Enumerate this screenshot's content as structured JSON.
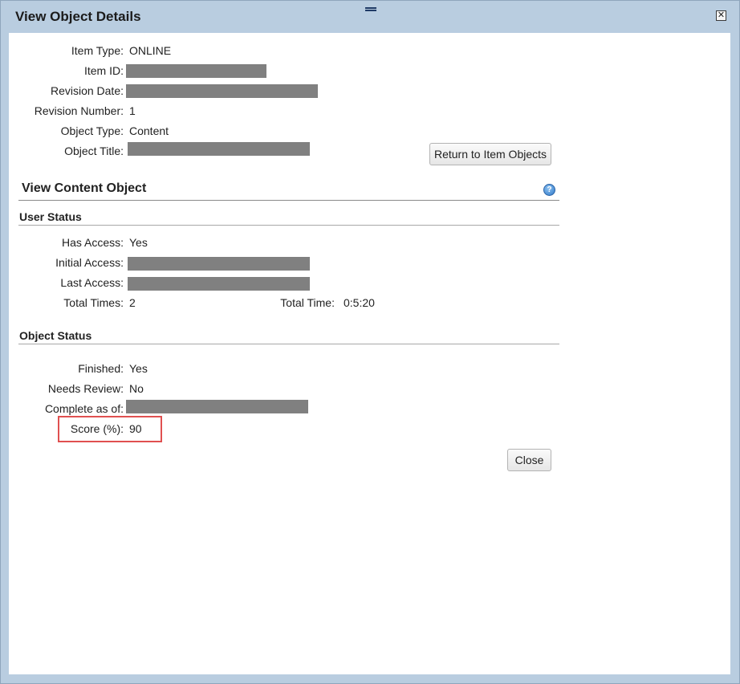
{
  "dialog": {
    "title": "View Object Details",
    "close_symbol": "✕"
  },
  "details": {
    "item_type": {
      "label": "Item Type:",
      "value": "ONLINE"
    },
    "item_id": {
      "label": "Item ID:"
    },
    "revision_date": {
      "label": "Revision Date:"
    },
    "revision_number": {
      "label": "Revision Number:",
      "value": "1"
    },
    "object_type": {
      "label": "Object Type:",
      "value": "Content"
    },
    "object_title": {
      "label": "Object Title:"
    }
  },
  "buttons": {
    "return_label": "Return to Item Objects",
    "close_label": "Close"
  },
  "section": {
    "title": "View Content Object",
    "help_glyph": "?"
  },
  "user_status": {
    "title": "User Status",
    "has_access": {
      "label": "Has Access:",
      "value": "Yes"
    },
    "initial_access": {
      "label": "Initial Access:"
    },
    "last_access": {
      "label": "Last Access:"
    },
    "total_times": {
      "label": "Total Times:",
      "value": "2"
    },
    "total_time": {
      "label": "Total Time:",
      "value": "0:5:20"
    }
  },
  "object_status": {
    "title": "Object Status",
    "finished": {
      "label": "Finished:",
      "value": "Yes"
    },
    "needs_review": {
      "label": "Needs Review:",
      "value": "No"
    },
    "complete_as_of": {
      "label": "Complete as of:"
    },
    "score": {
      "label": "Score (%):",
      "value": "90"
    }
  },
  "colors": {
    "title_bar": "#b9cde0",
    "redaction": "#808080",
    "highlight": "#e05050"
  },
  "icons": {
    "help": "help-icon",
    "close": "close-icon",
    "drag": "drag-handle-icon"
  }
}
